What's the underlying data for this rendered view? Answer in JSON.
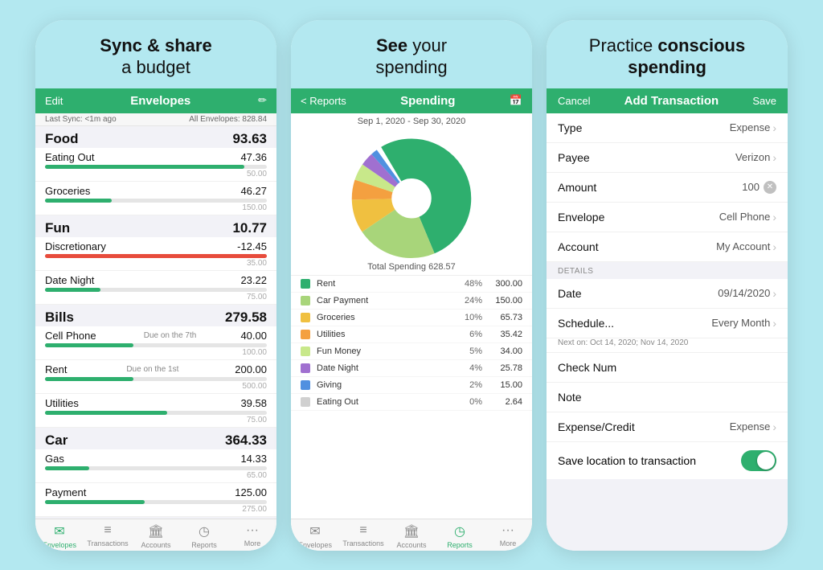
{
  "panels": [
    {
      "id": "envelopes",
      "headline_plain": "Sync & share",
      "headline_bold": "",
      "headline_line2": "a budget",
      "headline_bold_part": "Sync & share",
      "topbar": {
        "left": "Edit",
        "title": "Envelopes",
        "right": "✏️"
      },
      "subbar": {
        "left": "Last Sync: <1m ago",
        "right": "All Envelopes: 828.84"
      },
      "groups": [
        {
          "name": "Food",
          "total": "93.63",
          "items": [
            {
              "name": "Eating Out",
              "due": "",
              "amount": "47.36",
              "budget": "50.00",
              "fill": 90,
              "type": "green"
            },
            {
              "name": "Groceries",
              "due": "",
              "amount": "46.27",
              "budget": "150.00",
              "fill": 30,
              "type": "green"
            }
          ]
        },
        {
          "name": "Fun",
          "total": "10.77",
          "items": [
            {
              "name": "Discretionary",
              "due": "",
              "amount": "-12.45",
              "budget": "35.00",
              "fill": 100,
              "type": "red"
            },
            {
              "name": "Date Night",
              "due": "",
              "amount": "23.22",
              "budget": "75.00",
              "fill": 25,
              "type": "green"
            }
          ]
        },
        {
          "name": "Bills",
          "total": "279.58",
          "items": [
            {
              "name": "Cell Phone",
              "due": "Due on the 7th",
              "amount": "40.00",
              "budget": "100.00",
              "fill": 40,
              "type": "green"
            },
            {
              "name": "Rent",
              "due": "Due on the 1st",
              "amount": "200.00",
              "budget": "500.00",
              "fill": 40,
              "type": "green"
            },
            {
              "name": "Utilities",
              "due": "",
              "amount": "39.58",
              "budget": "75.00",
              "fill": 55,
              "type": "green"
            }
          ]
        },
        {
          "name": "Car",
          "total": "364.33",
          "items": [
            {
              "name": "Gas",
              "due": "",
              "amount": "14.33",
              "budget": "65.00",
              "fill": 20,
              "type": "green"
            },
            {
              "name": "Payment",
              "due": "",
              "amount": "125.00",
              "budget": "275.00",
              "fill": 45,
              "type": "green"
            }
          ]
        }
      ],
      "tabs": [
        {
          "icon": "✉",
          "label": "Envelopes",
          "active": true
        },
        {
          "icon": "≡",
          "label": "Transactions",
          "active": false
        },
        {
          "icon": "🏛",
          "label": "Accounts",
          "active": false
        },
        {
          "icon": "◷",
          "label": "Reports",
          "active": false
        },
        {
          "icon": "···",
          "label": "More",
          "active": false
        }
      ]
    },
    {
      "id": "reports",
      "headline_plain": "See your",
      "headline_bold_part": "See",
      "headline_line2": "spending",
      "topbar": {
        "left": "< Reports",
        "title": "Spending",
        "right": "📅"
      },
      "daterange": "Sep 1, 2020 - Sep 30, 2020",
      "total_label": "Total Spending 628.57",
      "legend": [
        {
          "name": "Rent",
          "pct": "48%",
          "amount": "300.00",
          "color": "#2eaf6e"
        },
        {
          "name": "Car Payment",
          "pct": "24%",
          "amount": "150.00",
          "color": "#a8d57a"
        },
        {
          "name": "Groceries",
          "pct": "10%",
          "amount": "65.73",
          "color": "#f0c040"
        },
        {
          "name": "Utilities",
          "pct": "6%",
          "amount": "35.42",
          "color": "#f4a040"
        },
        {
          "name": "Fun Money",
          "pct": "5%",
          "amount": "34.00",
          "color": "#c8e88a"
        },
        {
          "name": "Date Night",
          "pct": "4%",
          "amount": "25.78",
          "color": "#a070d0"
        },
        {
          "name": "Giving",
          "pct": "2%",
          "amount": "15.00",
          "color": "#5090e0"
        },
        {
          "name": "Eating Out",
          "pct": "0%",
          "amount": "2.64",
          "color": "#d0d0d0"
        }
      ],
      "tabs": [
        {
          "icon": "✉",
          "label": "Envelopes",
          "active": false
        },
        {
          "icon": "≡",
          "label": "Transactions",
          "active": false
        },
        {
          "icon": "🏛",
          "label": "Accounts",
          "active": false
        },
        {
          "icon": "◷",
          "label": "Reports",
          "active": true
        },
        {
          "icon": "···",
          "label": "More",
          "active": false
        }
      ]
    },
    {
      "id": "add-transaction",
      "headline_plain": "Practice ",
      "headline_bold_part": "conscious spending",
      "topbar": {
        "left": "Cancel",
        "title": "Add Transaction",
        "right": "Save"
      },
      "rows": [
        {
          "label": "Type",
          "value": "Expense"
        },
        {
          "label": "Payee",
          "value": "Verizon"
        },
        {
          "label": "Amount",
          "value": "100",
          "has_clear": true
        },
        {
          "label": "Envelope",
          "value": "Cell Phone"
        },
        {
          "label": "Account",
          "value": "My Account"
        }
      ],
      "details_header": "DETAILS",
      "detail_rows": [
        {
          "label": "Date",
          "value": "09/14/2020"
        },
        {
          "label": "Schedule...",
          "value": "Every Month",
          "sub": "Next on: Oct 14, 2020; Nov 14, 2020"
        },
        {
          "label": "Check Num",
          "value": ""
        },
        {
          "label": "Note",
          "value": ""
        },
        {
          "label": "Expense/Credit",
          "value": "Expense"
        }
      ],
      "toggle_label": "Save location to transaction",
      "toggle_on": true
    }
  ]
}
